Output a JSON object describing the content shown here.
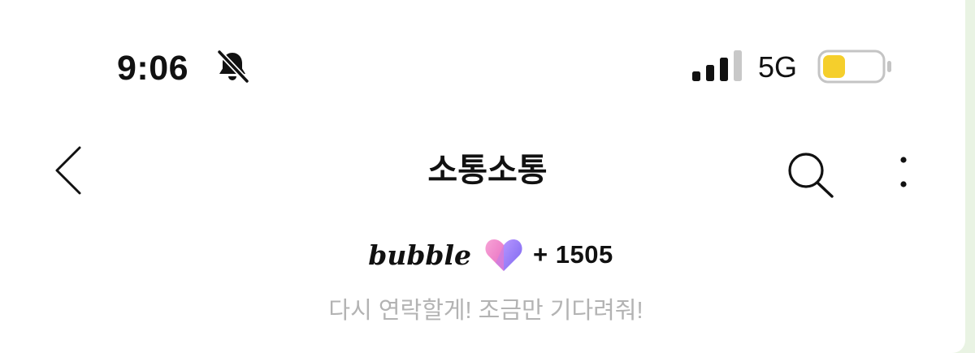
{
  "status_bar": {
    "time": "9:06",
    "network": "5G",
    "silent_icon": "bell-slash-icon",
    "signal_icon": "cellular-signal-icon",
    "signal_level": 0.75,
    "battery_icon": "battery-icon",
    "battery_level": 0.3,
    "battery_color": "#f5cf2c"
  },
  "nav": {
    "title": "소통소통",
    "back_icon": "chevron-left-icon",
    "search_icon": "search-icon",
    "more_icon": "more-vertical-icon"
  },
  "bubble": {
    "logo_text": "bubble",
    "heart_icon": "gradient-heart-icon",
    "heart_colors": [
      "#f28ac8",
      "#8a6cf2"
    ],
    "count_text": "+ 1505"
  },
  "message": {
    "text": "다시 연락할게! 조금만 기다려줘!"
  },
  "colors": {
    "background_edge": "#e9f3e3",
    "subtitle_gray": "#b3b3b3"
  }
}
